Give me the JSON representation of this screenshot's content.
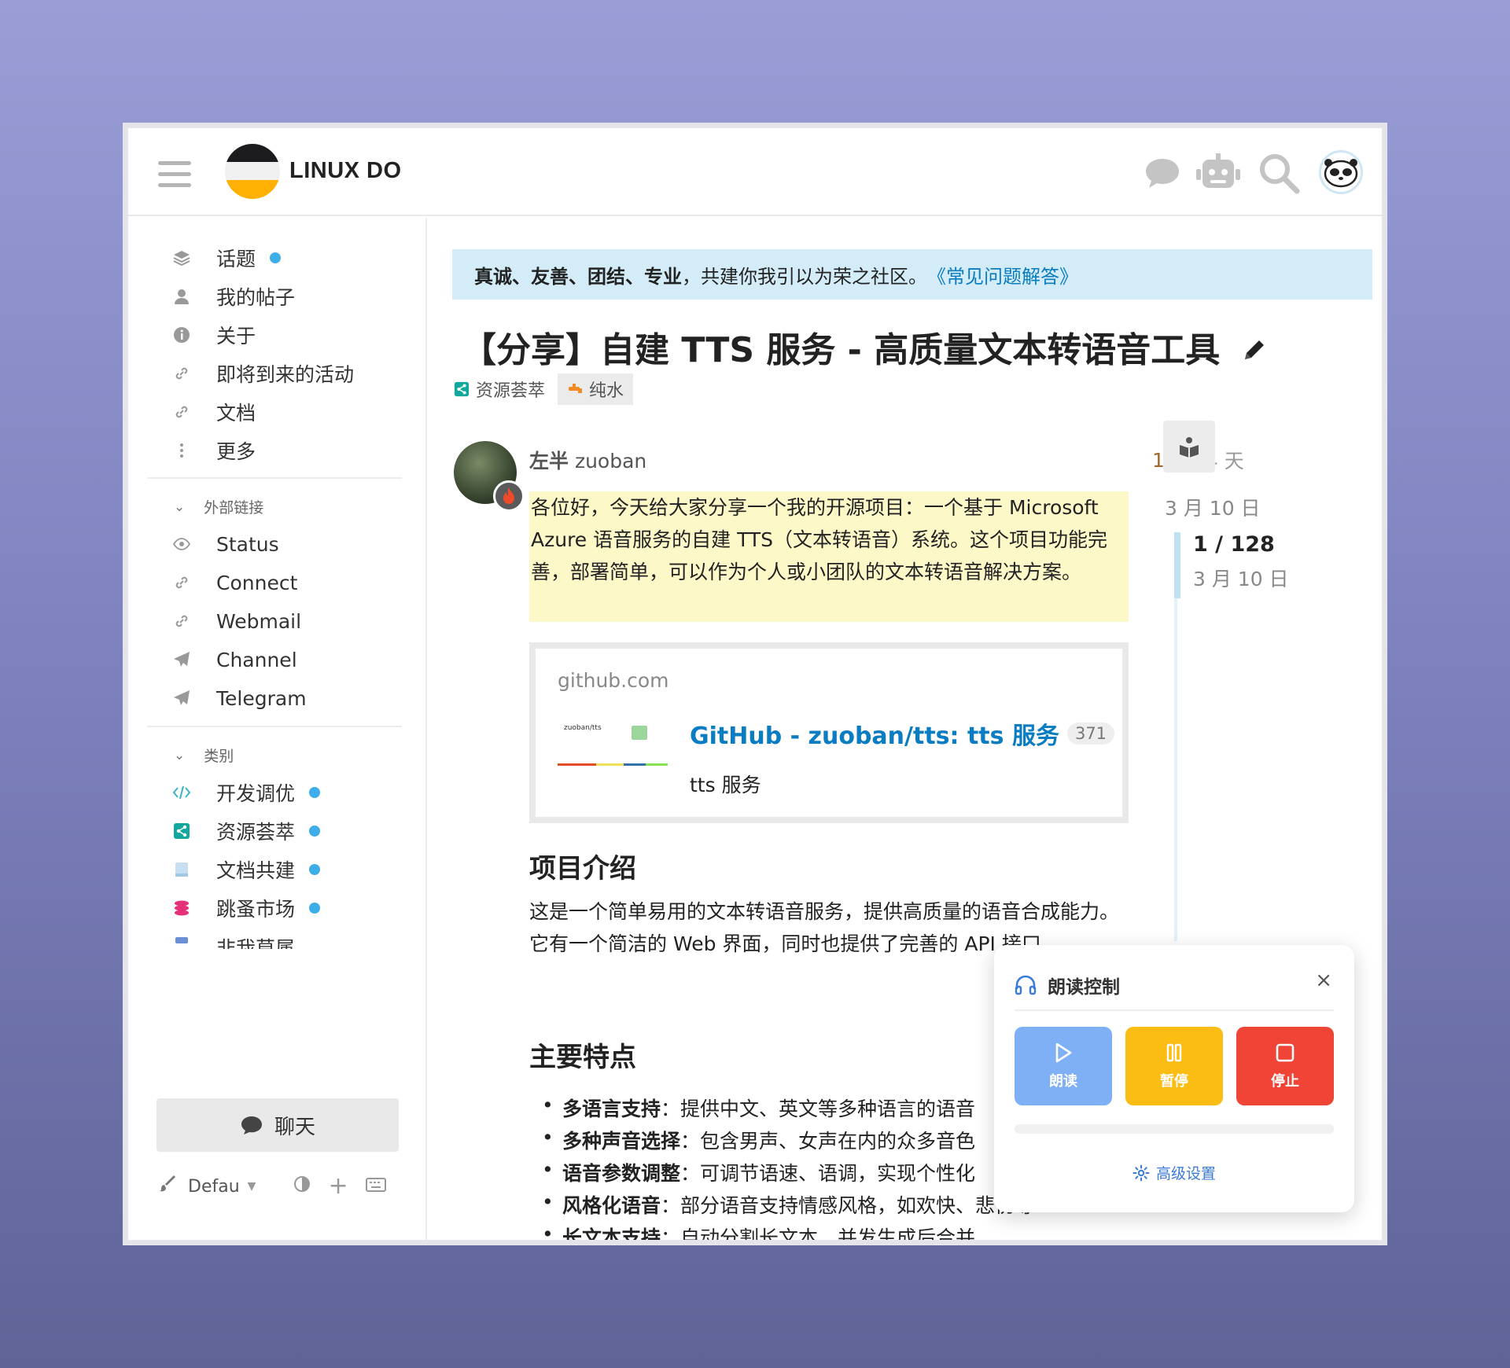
{
  "header": {
    "site_name": "LINUX DO"
  },
  "sidebar": {
    "items": [
      {
        "label": "话题"
      },
      {
        "label": "我的帖子"
      },
      {
        "label": "关于"
      },
      {
        "label": "即将到来的活动"
      },
      {
        "label": "文档"
      },
      {
        "label": "更多"
      }
    ],
    "external_heading": "外部链接",
    "external": [
      {
        "label": "Status"
      },
      {
        "label": "Connect"
      },
      {
        "label": "Webmail"
      },
      {
        "label": "Channel"
      },
      {
        "label": "Telegram"
      }
    ],
    "categories_heading": "类别",
    "categories": [
      {
        "label": "开发调优",
        "color": "#3ab4c4"
      },
      {
        "label": "资源荟萃",
        "color": "#12a89d"
      },
      {
        "label": "文档共建",
        "color": "#9ec8e6"
      },
      {
        "label": "跳蚤市场",
        "color": "#e4317a"
      },
      {
        "label": "非我莫属",
        "color": "#6b8fd6"
      }
    ],
    "chat_label": "聊天",
    "theme_label": "Defau"
  },
  "banner": {
    "strong": "真诚、友善、团结、专业",
    "rest": "，共建你我引以为荣之社区。",
    "link": "《常见问题解答》"
  },
  "topic": {
    "title": "【分享】自建 TTS 服务 - 高质量文本转语音工具",
    "category": "资源荟萃",
    "tag": "纯水"
  },
  "post": {
    "author_name": "左半",
    "author_user": "zuoban",
    "edit_count": "1",
    "age": "4 天",
    "intro": "各位好，今天给大家分享一个我的开源项目：一个基于 Microsoft Azure 语音服务的自建 TTS（文本转语音）系统。这个项目功能完善，部署简单，可以作为个人或小团队的文本转语音解决方案。",
    "onebox": {
      "source": "github.com",
      "title": "GitHub - zuoban/tts: tts 服务",
      "count": "371",
      "desc": "tts 服务",
      "thumb_label": "zuoban/tts"
    },
    "h_intro": "项目介绍",
    "para_intro": "这是一个简单易用的文本转语音服务，提供高质量的语音合成能力。它有一个简洁的 Web 界面，同时也提供了完善的 API 接口。",
    "h_features": "主要特点",
    "features": [
      {
        "bold": "多语言支持",
        "rest": "：提供中文、英文等多种语言的语音"
      },
      {
        "bold": "多种声音选择",
        "rest": "：包含男声、女声在内的众多音色"
      },
      {
        "bold": "语音参数调整",
        "rest": "：可调节语速、语调，实现个性化"
      },
      {
        "bold": "风格化语音",
        "rest": "：部分语音支持情感风格，如欢快、悲伤等"
      },
      {
        "bold": "长文本支持",
        "rest": "：自动分割长文本，并发生成后合并"
      }
    ]
  },
  "timeline": {
    "top_date": "3 月 10 日",
    "position": "1 / 128",
    "position_date": "3 月 10 日"
  },
  "reader_panel": {
    "title": "朗读控制",
    "close": "×",
    "play": "朗读",
    "pause": "暂停",
    "stop": "停止",
    "advanced": "高级设置",
    "colors": {
      "play": "#7fb0f5",
      "pause": "#fbbd14",
      "stop": "#ef4436"
    }
  }
}
